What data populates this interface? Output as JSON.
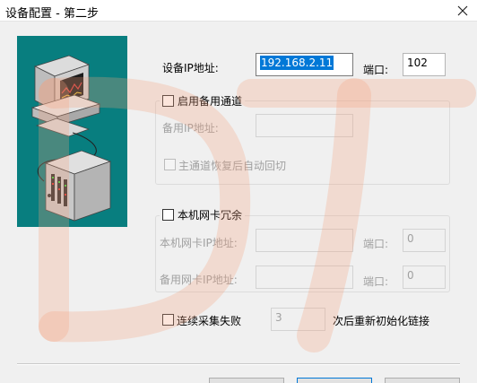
{
  "window": {
    "title": "设备配置 - 第二步",
    "close_icon": "close-icon"
  },
  "illustration": {
    "background": "#087e7f",
    "icons": [
      "computer-icon",
      "plc-device-icon"
    ]
  },
  "primary": {
    "ip_label": "设备IP地址:",
    "ip_value": "192.168.2.11",
    "port_label": "端口:",
    "port_value": "102"
  },
  "backup_channel": {
    "checkbox_label": "启用备用通道",
    "checked": false,
    "ip_label": "备用IP地址:",
    "ip_value": "",
    "auto_switch_label": "主通道恢复后自动回切",
    "auto_switch_checked": false
  },
  "nic_redundancy": {
    "checkbox_label": "本机网卡冗余",
    "checked": false,
    "local_ip_label": "本机网卡IP地址:",
    "local_ip_value": "",
    "local_port_label": "端口:",
    "local_port_value": "0",
    "backup_ip_label": "备用网卡IP地址:",
    "backup_ip_value": "",
    "backup_port_label": "端口:",
    "backup_port_value": "0"
  },
  "reinit": {
    "checkbox_label": "连续采集失败",
    "checked": false,
    "count_value": "3",
    "suffix_label": "次后重新初始化链接"
  },
  "watermark": {
    "text": "DT",
    "color": "#f3a37f"
  },
  "colors": {
    "selection": "#0078d7",
    "window_bg": "#f0f0f0",
    "panel_teal": "#087e7f"
  }
}
